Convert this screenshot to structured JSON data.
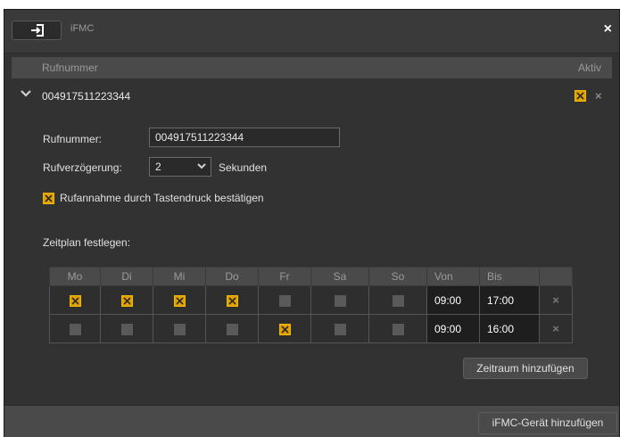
{
  "window": {
    "title": "iFMC",
    "icon": "arrow-into-box-icon",
    "close": "×"
  },
  "list_header": {
    "number_col": "Rufnummer",
    "active_col": "Aktiv"
  },
  "entry": {
    "number": "004917511223344",
    "expanded": true,
    "active": true,
    "delete": "×"
  },
  "form": {
    "number_label": "Rufnummer:",
    "number_value": "004917511223344",
    "delay_label": "Rufverzögerung:",
    "delay_value": "2",
    "delay_unit": "Sekunden",
    "confirm_label": "Rufannahme durch Tastendruck bestätigen",
    "confirm_checked": true
  },
  "schedule": {
    "label": "Zeitplan festlegen:",
    "headers": [
      "Mo",
      "Di",
      "Mi",
      "Do",
      "Fr",
      "Sa",
      "So",
      "Von",
      "Bis"
    ],
    "rows": [
      {
        "days": [
          true,
          true,
          true,
          true,
          false,
          false,
          false
        ],
        "from": "09:00",
        "to": "17:00",
        "delete": "×"
      },
      {
        "days": [
          false,
          false,
          false,
          false,
          true,
          false,
          false
        ],
        "from": "09:00",
        "to": "16:00",
        "delete": "×"
      }
    ],
    "add_button": "Zeitraum hinzufügen"
  },
  "footer": {
    "add_device_button": "iFMC-Gerät hinzufügen"
  },
  "colors": {
    "accent": "#e0a000",
    "panel": "#323232",
    "header": "#4a4a4a"
  }
}
